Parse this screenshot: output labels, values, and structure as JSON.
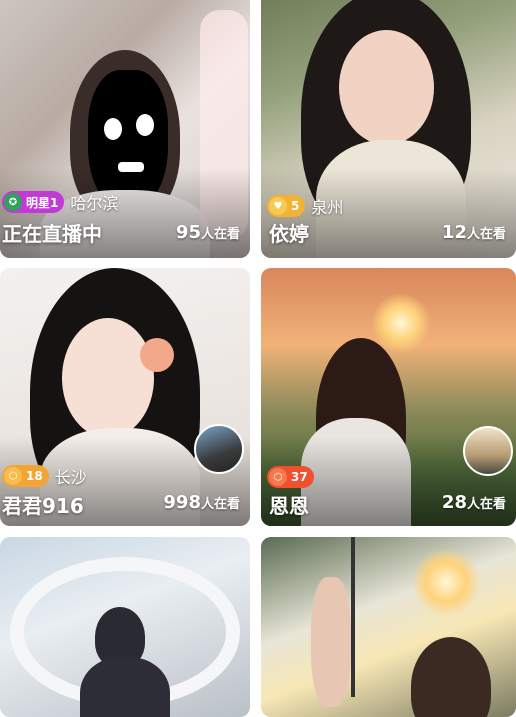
{
  "cards": [
    {
      "badge": {
        "label": "明星1",
        "color": "#c23ad6",
        "icon": "star-level-icon"
      },
      "city": "哈尔滨",
      "name": "正在直播中",
      "viewers": {
        "count": "95",
        "label": "人在看"
      }
    },
    {
      "badge": {
        "label": "5",
        "color": "#f2b233",
        "icon": "heart-level-icon"
      },
      "city": "泉州",
      "name": "依婷",
      "viewers": {
        "count": "12",
        "label": "人在看"
      }
    },
    {
      "badge": {
        "label": "18",
        "color": "#f2a533",
        "icon": "hexagon-level-icon"
      },
      "city": "长沙",
      "name": "君君916",
      "viewers": {
        "count": "998",
        "label": "人在看"
      },
      "has_avatar": true
    },
    {
      "badge": {
        "label": "37",
        "color": "#f0502e",
        "icon": "hexagon-level-icon"
      },
      "city": "",
      "name": "恩恩",
      "viewers": {
        "count": "28",
        "label": "人在看"
      },
      "has_avatar": true
    },
    {
      "image": "dragon-artwork"
    },
    {
      "image": "peace-sign-selfie"
    }
  ]
}
